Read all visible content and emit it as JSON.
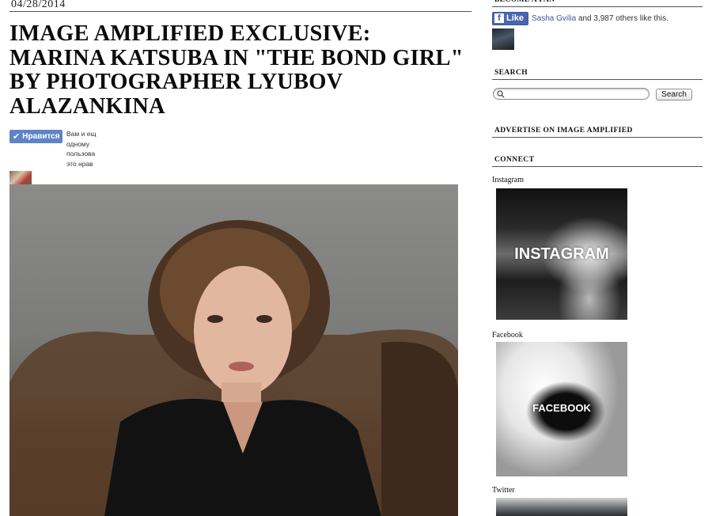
{
  "post": {
    "date": "04/28/2014",
    "title": "IMAGE AMPLIFIED EXCLUSIVE: MARINA KATSUBA IN \"THE BOND GIRL\" BY PHOTOGRAPHER LYUBOV ALAZANKINA",
    "vk_like": {
      "button_label": "Нравится",
      "text": "Вам и ещ\nодному\nпользова\nэто нрав"
    }
  },
  "sidebar": {
    "fan": {
      "heading": "BECOME A FAN",
      "like_label": "Like",
      "liker_name": "Sasha Gvilia",
      "like_rest": "and 3,987 others like this."
    },
    "search": {
      "heading": "SEARCH",
      "placeholder": "",
      "button_label": "Search"
    },
    "advertise": {
      "heading": "ADVERTISE ON IMAGE AMPLIFIED"
    },
    "connect": {
      "heading": "CONNECT",
      "items": [
        {
          "label": "Instagram",
          "caption": "INSTAGRAM"
        },
        {
          "label": "Facebook",
          "caption": "FACEBOOK"
        },
        {
          "label": "Twitter",
          "caption": ""
        }
      ]
    }
  },
  "colors": {
    "vk_blue": "#5f84c4",
    "fb_blue": "#4a66ad",
    "fb_link": "#3b5998",
    "rule": "#555555"
  },
  "icons": [
    "check-icon",
    "facebook-f-icon",
    "search-icon"
  ]
}
